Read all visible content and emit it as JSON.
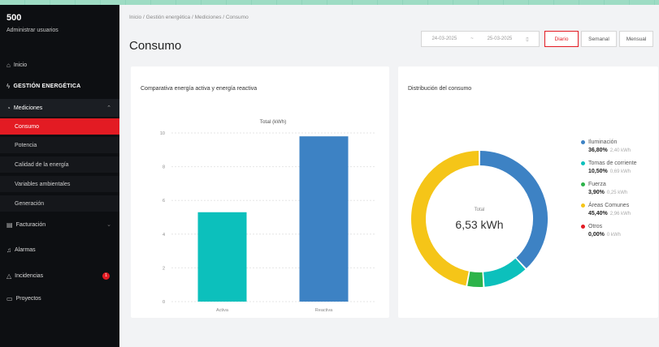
{
  "sidebar": {
    "brand": "500",
    "subtitle": "Administrar usuarios",
    "items": [
      {
        "label": "Inicio",
        "icon": "home-icon"
      },
      {
        "label": "GESTIÓN ENERGÉTICA"
      },
      {
        "label": "Mediciones",
        "icon": "gauge-icon"
      },
      {
        "label": "Consumo"
      },
      {
        "label": "Potencia"
      },
      {
        "label": "Calidad de la energía"
      },
      {
        "label": "Variables ambientales"
      },
      {
        "label": "Generación"
      },
      {
        "label": "Facturación",
        "icon": "invoice-icon"
      },
      {
        "label": "Alarmas",
        "icon": "bell-icon"
      },
      {
        "label": "Incidencias",
        "icon": "alert-icon"
      },
      {
        "label": "Proyectos",
        "icon": "folder-icon"
      }
    ],
    "incidencias_badge": "1"
  },
  "header": {
    "breadcrumb": "Inicio / Gestión energética / Mediciones / Consumo",
    "title": "Consumo",
    "date_from": "24-03-2025",
    "date_sep": "~",
    "date_to": "25-03-2025",
    "buttons": [
      "Diario",
      "Semanal",
      "Mensual"
    ],
    "active_button": "Diario"
  },
  "bar_card": {
    "title": "Comparativa energía activa y energía reactiva"
  },
  "donut_card": {
    "title": "Distribución del consumo",
    "center_label": "Total",
    "center_value": "6,53 kWh"
  },
  "chart_data": [
    {
      "type": "bar",
      "title": "Total (kWh)",
      "categories": [
        "Activa",
        "Reactiva"
      ],
      "values": [
        5.3,
        9.8
      ],
      "colors": [
        "#0cc0bc",
        "#3d82c4"
      ],
      "yticks": [
        0,
        2,
        4,
        6,
        8,
        10
      ],
      "ylim": [
        0,
        10
      ],
      "grid": true
    },
    {
      "type": "pie",
      "categories": [
        "Iluminación",
        "Tomas de corriente",
        "Fuerza",
        "Áreas Comunes",
        "Otros"
      ],
      "values": [
        36.8,
        10.5,
        3.9,
        45.4,
        0.0
      ],
      "percent_labels": [
        "36,80%",
        "10,50%",
        "3,90%",
        "45,40%",
        "0,00%"
      ],
      "value_labels": [
        "2,40 kWh",
        "0,69 kWh",
        "0,25 kWh",
        "2,96 kWh",
        "0 kWh"
      ],
      "colors": [
        "#3d82c4",
        "#0cc0bc",
        "#2db34a",
        "#f5c518",
        "#e31b23"
      ],
      "legend": "right"
    }
  ]
}
